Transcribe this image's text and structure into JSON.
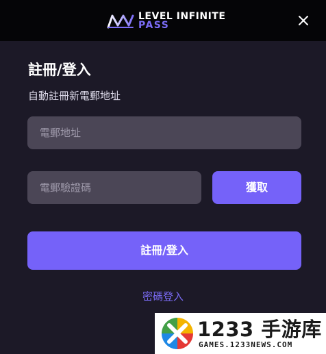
{
  "header": {
    "brand_line1": "LEVEL INFINITE",
    "brand_line2": "PASS",
    "close_icon": "close-icon"
  },
  "form": {
    "title": "註冊/登入",
    "subtitle": "自動註冊新電郵地址",
    "email_placeholder": "電郵地址",
    "code_placeholder": "電郵驗證碼",
    "get_code_label": "獲取",
    "submit_label": "註冊/登入",
    "password_login_label": "密碼登入"
  },
  "watermark": {
    "title": "1233 手游库",
    "subtitle": "GAMES.1233NEWS.COM"
  },
  "colors": {
    "accent": "#7562f9",
    "background": "#1c1927",
    "header_background": "#050507",
    "input_background": "#4b4656",
    "link": "#7b6cf6"
  }
}
